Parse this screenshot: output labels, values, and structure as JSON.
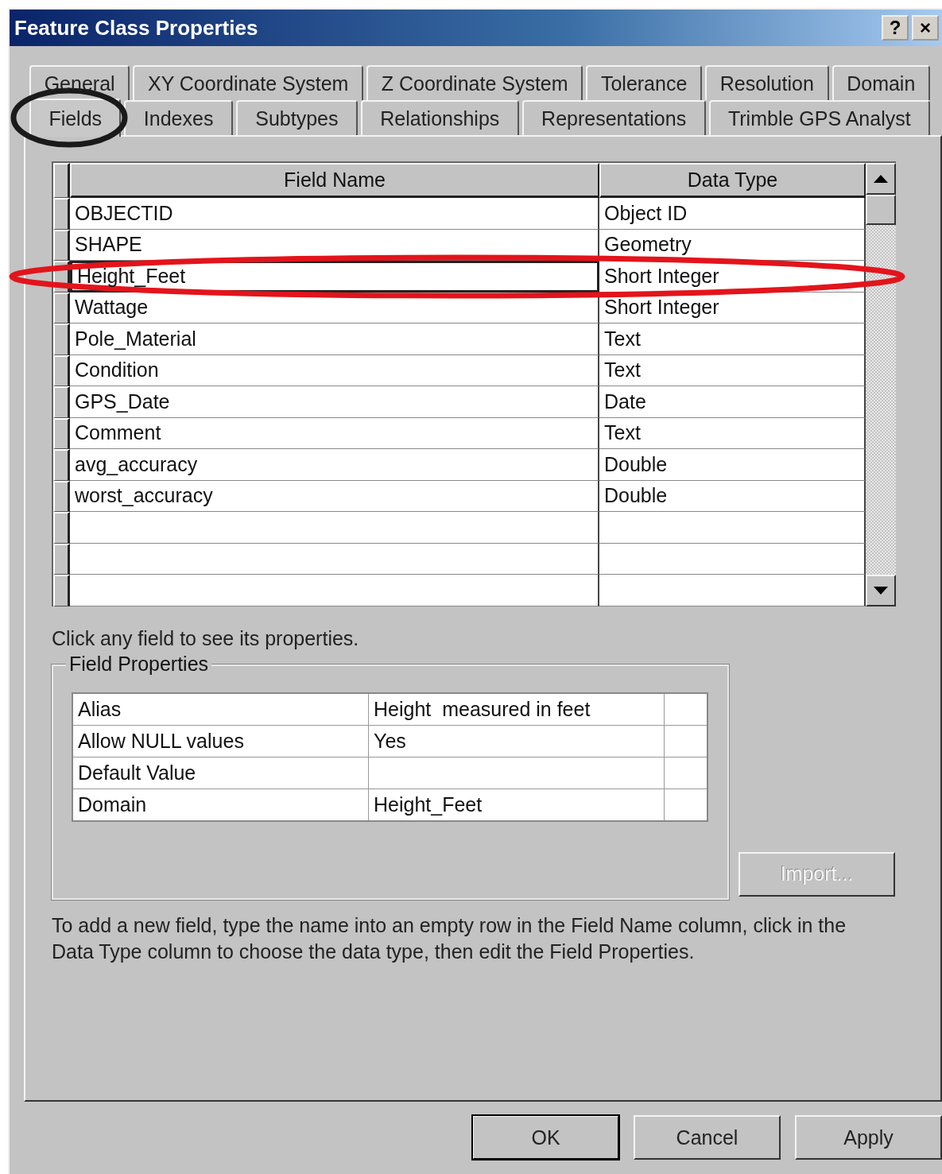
{
  "window": {
    "title": "Feature Class Properties",
    "help_button": "?",
    "close_button": "×"
  },
  "tab_rows": [
    {
      "tabs": [
        {
          "label": "General",
          "selected": false
        },
        {
          "label": "XY Coordinate System",
          "selected": false
        },
        {
          "label": "Z Coordinate System",
          "selected": false
        },
        {
          "label": "Tolerance",
          "selected": false
        },
        {
          "label": "Resolution",
          "selected": false
        },
        {
          "label": "Domain",
          "selected": false
        }
      ]
    },
    {
      "tabs": [
        {
          "label": "Fields",
          "selected": true
        },
        {
          "label": "Indexes",
          "selected": false
        },
        {
          "label": "Subtypes",
          "selected": false
        },
        {
          "label": "Relationships",
          "selected": false
        },
        {
          "label": "Representations",
          "selected": false
        },
        {
          "label": "Trimble GPS Analyst",
          "selected": false
        }
      ]
    }
  ],
  "fields_table": {
    "columns": [
      "Field Name",
      "Data Type"
    ],
    "rows": [
      {
        "kind": "field",
        "field_name": "OBJECTID",
        "data_type": "Object ID",
        "selected": false
      },
      {
        "kind": "field",
        "field_name": "SHAPE",
        "data_type": "Geometry",
        "selected": false
      },
      {
        "kind": "field",
        "field_name": "Height_Feet",
        "data_type": "Short Integer",
        "selected": true
      },
      {
        "kind": "field",
        "field_name": "Wattage",
        "data_type": "Short Integer",
        "selected": false
      },
      {
        "kind": "field",
        "field_name": "Pole_Material",
        "data_type": "Text",
        "selected": false
      },
      {
        "kind": "field",
        "field_name": "Condition",
        "data_type": "Text",
        "selected": false
      },
      {
        "kind": "field",
        "field_name": "GPS_Date",
        "data_type": "Date",
        "selected": false
      },
      {
        "kind": "field",
        "field_name": "Comment",
        "data_type": "Text",
        "selected": false
      },
      {
        "kind": "field",
        "field_name": "avg_accuracy",
        "data_type": "Double",
        "selected": false
      },
      {
        "kind": "field",
        "field_name": "worst_accuracy",
        "data_type": "Double",
        "selected": false
      },
      {
        "kind": "empty"
      },
      {
        "kind": "empty"
      },
      {
        "kind": "empty"
      }
    ]
  },
  "hint": "Click any field to see its properties.",
  "field_properties": {
    "title": "Field Properties",
    "rows": [
      {
        "name": "Alias",
        "value": "Height  measured in feet"
      },
      {
        "name": "Allow NULL values",
        "value": "Yes"
      },
      {
        "name": "Default Value"
      },
      {
        "name": "Domain",
        "value": "Height_Feet"
      }
    ],
    "import_button": {
      "label": "Import...",
      "disabled": true
    }
  },
  "footer_note": "To add a new field, type the name into an empty row in the Field Name column, click in the Data Type column to choose the data type, then edit the Field Properties.",
  "buttons": [
    {
      "label": "OK",
      "default": true
    },
    {
      "label": "Cancel",
      "default": false
    },
    {
      "label": "Apply",
      "default": false
    }
  ],
  "annotations": [
    {
      "kind": "tab-circle",
      "color": "#1a1a1a"
    },
    {
      "kind": "row-circle",
      "color": "#e3141b"
    }
  ]
}
